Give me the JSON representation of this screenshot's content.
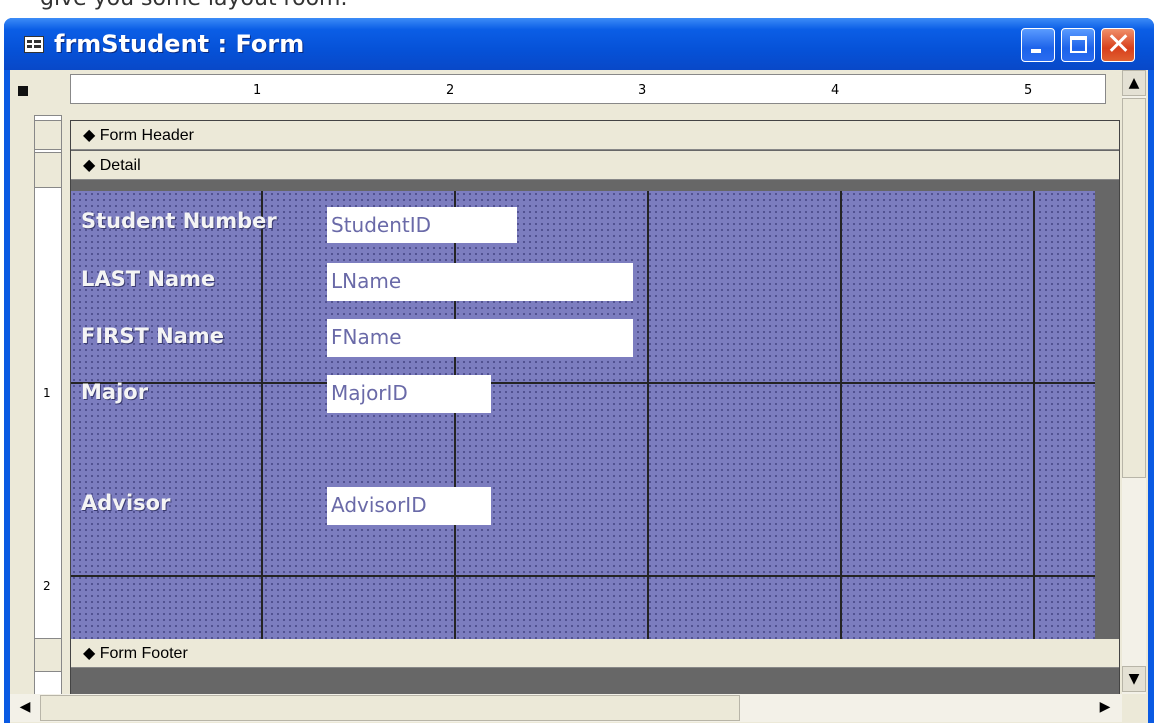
{
  "page_note": "give you some layout room.",
  "window": {
    "title": "frmStudent : Form",
    "controls": {
      "minimize": "minimize",
      "maximize": "maximize",
      "close": "✕"
    }
  },
  "ruler": {
    "horizontal_numbers": [
      "1",
      "2",
      "3",
      "4",
      "5"
    ],
    "vertical_numbers": [
      "1",
      "2"
    ]
  },
  "sections": {
    "header": "Form Header",
    "detail": "Detail",
    "footer": "Form Footer"
  },
  "detail_controls": [
    {
      "label": "Student Number",
      "field": "StudentID"
    },
    {
      "label": "LAST Name",
      "field": "LName"
    },
    {
      "label": "FIRST Name",
      "field": "FName"
    },
    {
      "label": "Major",
      "field": "MajorID"
    },
    {
      "label": "Advisor",
      "field": "AdvisorID"
    }
  ],
  "colors": {
    "detail_background": "#7c7dbf",
    "title_bar": "#0652d8",
    "label_text": "#f4f4f4"
  },
  "icons": {
    "section_marker": "section-arrow-icon",
    "title": "form-icon"
  }
}
